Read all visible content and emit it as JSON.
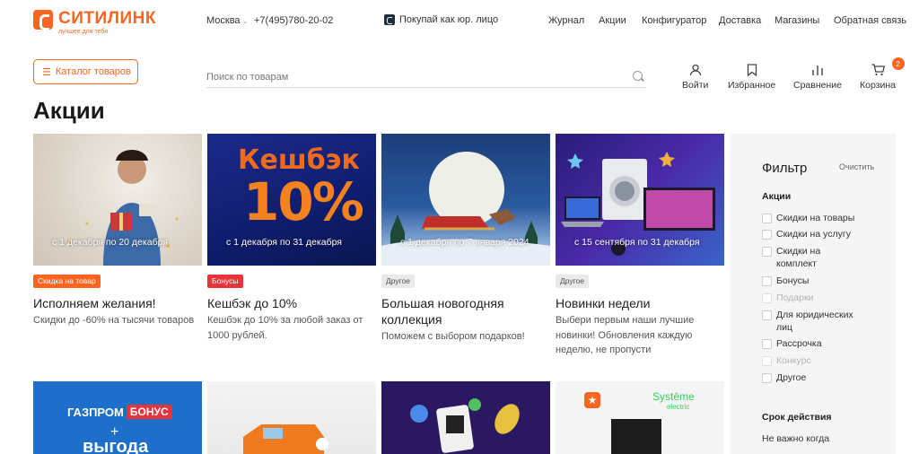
{
  "header": {
    "logo": {
      "name": "СИТИЛИНК",
      "slogan": "лучшее для тебя"
    },
    "city": "Москва",
    "phone": "+7(495)780-20-02",
    "business_link": "Покупай как юр. лицо",
    "nav": [
      "Журнал",
      "Акции",
      "Конфигуратор",
      "Доставка",
      "Магазины",
      "Обратная связь"
    ],
    "catalog_button": "Каталог товаров",
    "search": {
      "placeholder": "Поиск по товарам",
      "value": ""
    },
    "actions": [
      {
        "label": "Войти",
        "icon": "user-icon"
      },
      {
        "label": "Избранное",
        "icon": "bookmark-icon"
      },
      {
        "label": "Сравнение",
        "icon": "compare-icon"
      },
      {
        "label": "Корзина",
        "icon": "cart-icon",
        "badge": "2"
      }
    ],
    "accent_color": "#fc6420"
  },
  "page": {
    "title": "Акции"
  },
  "cards": [
    {
      "date": "с 1 декабря по 20 декабря",
      "tag": "Скидка на товар",
      "tag_color": "orange",
      "title": "Исполняем желания!",
      "description": "Скидки до -60% на тысячи товаров"
    },
    {
      "date": "с 1 декабря по 31 декабря",
      "tag": "Бонусы",
      "tag_color": "red",
      "title": "Кешбэк до 10%",
      "description": "Кешбэк до 10% за любой заказ от 1000 рублей.",
      "banner_text": "Кешбэк",
      "banner_amount": "10%"
    },
    {
      "date": "с 1 декабря по 7 января 2024",
      "tag": "Другое",
      "tag_color": "gray",
      "title": "Большая новогодняя коллекция",
      "description": "Поможем с выбором подарков!"
    },
    {
      "date": "с 15 сентября по 31 декабря",
      "tag": "Другое",
      "tag_color": "gray",
      "title": "Новинки недели",
      "description": "Выбери первым наши лучшие новинки! Обновления каждую неделю, не пропусти"
    }
  ],
  "second_row": {
    "gazprom_text": "ГАЗПРОМ",
    "gazprom_bonus": "БОНУС",
    "gazprom_sub": "выгода",
    "systeme_brand": "Systēme",
    "systeme_sub": "electric"
  },
  "filter": {
    "title": "Фильтр",
    "clear": "Очистить",
    "promotions_heading": "Акции",
    "options": [
      {
        "label": "Скидки на товары",
        "disabled": false
      },
      {
        "label": "Скидки на услугу",
        "disabled": false
      },
      {
        "label": "Скидки на комплект",
        "disabled": false
      },
      {
        "label": "Бонусы",
        "disabled": false
      },
      {
        "label": "Подарки",
        "disabled": true
      },
      {
        "label": "Для юридических лиц",
        "disabled": false
      },
      {
        "label": "Рассрочка",
        "disabled": false
      },
      {
        "label": "Конкурс",
        "disabled": true
      },
      {
        "label": "Другое",
        "disabled": false
      }
    ],
    "duration_heading": "Срок действия",
    "duration_first": "Не важно когда"
  }
}
